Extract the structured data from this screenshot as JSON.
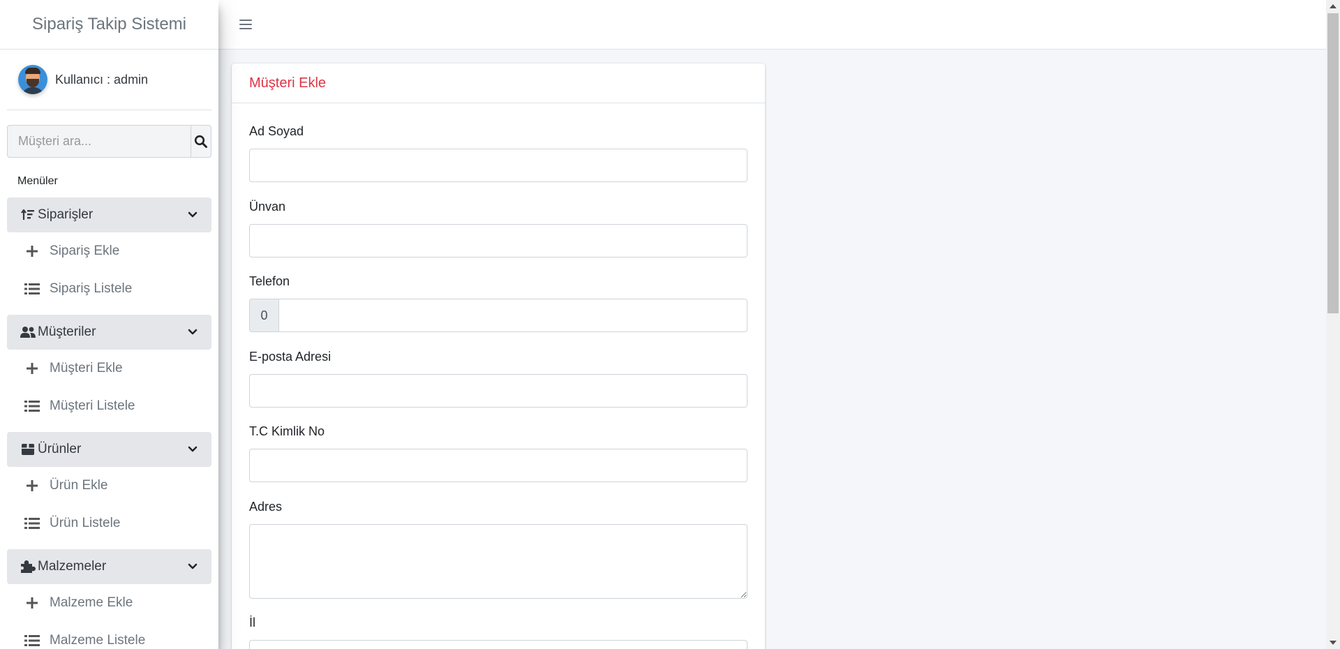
{
  "brand": {
    "title": "Sipariş Takip Sistemi"
  },
  "user": {
    "label": "Kullanıcı : admin"
  },
  "search": {
    "placeholder": "Müşteri ara..."
  },
  "nav": {
    "header": "Menüler",
    "groups": [
      {
        "label": "Siparişler",
        "icon": "sort-amount-up-icon",
        "items": [
          {
            "label": "Sipariş Ekle",
            "icon": "plus-icon"
          },
          {
            "label": "Sipariş Listele",
            "icon": "list-icon"
          }
        ]
      },
      {
        "label": "Müşteriler",
        "icon": "users-icon",
        "items": [
          {
            "label": "Müşteri Ekle",
            "icon": "plus-icon"
          },
          {
            "label": "Müşteri Listele",
            "icon": "list-icon"
          }
        ]
      },
      {
        "label": "Ürünler",
        "icon": "box-icon",
        "items": [
          {
            "label": "Ürün Ekle",
            "icon": "plus-icon"
          },
          {
            "label": "Ürün Listele",
            "icon": "list-icon"
          }
        ]
      },
      {
        "label": "Malzemeler",
        "icon": "puzzle-icon",
        "items": [
          {
            "label": "Malzeme Ekle",
            "icon": "plus-icon"
          },
          {
            "label": "Malzeme Listele",
            "icon": "list-icon"
          }
        ]
      }
    ]
  },
  "form": {
    "title": "Müşteri Ekle",
    "fields": {
      "ad_soyad": {
        "label": "Ad Soyad",
        "value": ""
      },
      "unvan": {
        "label": "Ünvan",
        "value": ""
      },
      "telefon": {
        "label": "Telefon",
        "prefix": "0",
        "value": ""
      },
      "eposta": {
        "label": "E-posta Adresi",
        "value": ""
      },
      "tc": {
        "label": "T.C Kimlik No",
        "value": ""
      },
      "adres": {
        "label": "Adres",
        "value": ""
      },
      "il": {
        "label": "İl"
      }
    }
  },
  "colors": {
    "title_red": "#dc3545",
    "group_bg": "#e4e6e9",
    "page_bg": "#f4f6f9"
  }
}
